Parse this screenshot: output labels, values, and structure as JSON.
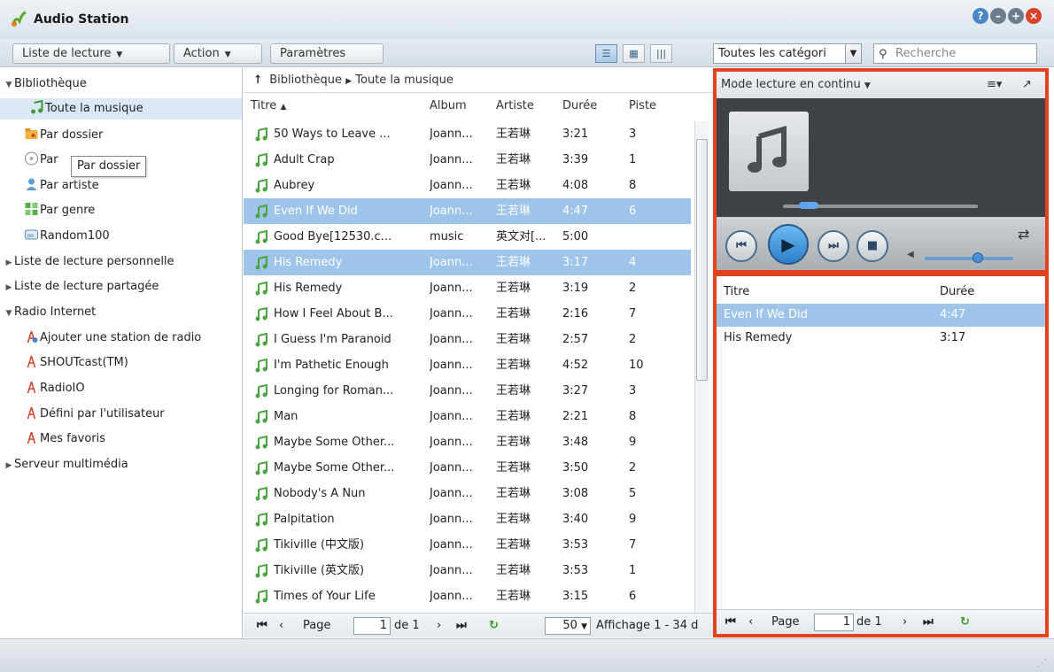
{
  "app": {
    "title": "Audio Station"
  },
  "toolbar": {
    "playlist_label": "Liste de lecture",
    "action_label": "Action",
    "settings_label": "Paramètres",
    "category_value": "Toutes les catégori",
    "search_placeholder": "Recherche"
  },
  "sidebar": {
    "library": "Bibliothèque",
    "all_music": "Toute la musique",
    "by_folder": "Par dossier",
    "by_album": "Par ",
    "by_artist": "Par artiste",
    "by_genre": "Par genre",
    "random100": "Random100",
    "personal_playlist": "Liste de lecture personnelle",
    "shared_playlist": "Liste de lecture partagée",
    "internet_radio": "Radio Internet",
    "add_station": "Ajouter une station de radio",
    "shoutcast": "SHOUTcast(TM)",
    "radioio": "RadioIO",
    "user_defined": "Défini par l'utilisateur",
    "favorites": "Mes favoris",
    "media_server": "Serveur multimédia",
    "tooltip": "Par dossier"
  },
  "center": {
    "breadcrumb_root": "Bibliothèque",
    "breadcrumb_current": "Toute la musique",
    "columns": {
      "title": "Titre",
      "album": "Album",
      "artist": "Artiste",
      "duration": "Durée",
      "track": "Piste"
    },
    "rows": [
      {
        "title": "50 Ways to Leave ...",
        "album": "Joann...",
        "artist": "王若琳",
        "duration": "3:21",
        "track": "3",
        "selected": false
      },
      {
        "title": "Adult Crap",
        "album": "Joann...",
        "artist": "王若琳",
        "duration": "3:39",
        "track": "1",
        "selected": false
      },
      {
        "title": "Aubrey",
        "album": "Joann...",
        "artist": "王若琳",
        "duration": "4:08",
        "track": "8",
        "selected": false
      },
      {
        "title": "Even If We Did",
        "album": "Joann...",
        "artist": "王若琳",
        "duration": "4:47",
        "track": "6",
        "selected": true
      },
      {
        "title": "Good Bye[12530.c...",
        "album": "music",
        "artist": "英文对[...",
        "duration": "5:00",
        "track": "",
        "selected": false
      },
      {
        "title": "His Remedy",
        "album": "Joann...",
        "artist": "王若琳",
        "duration": "3:17",
        "track": "4",
        "selected": true
      },
      {
        "title": "His Remedy",
        "album": "Joann...",
        "artist": "王若琳",
        "duration": "3:19",
        "track": "2",
        "selected": false
      },
      {
        "title": "How I Feel About B...",
        "album": "Joann...",
        "artist": "王若琳",
        "duration": "2:16",
        "track": "7",
        "selected": false
      },
      {
        "title": "I Guess I'm Paranoid",
        "album": "Joann...",
        "artist": "王若琳",
        "duration": "2:57",
        "track": "2",
        "selected": false
      },
      {
        "title": "I'm Pathetic Enough",
        "album": "Joann...",
        "artist": "王若琳",
        "duration": "4:52",
        "track": "10",
        "selected": false
      },
      {
        "title": "Longing for Roman...",
        "album": "Joann...",
        "artist": "王若琳",
        "duration": "3:27",
        "track": "3",
        "selected": false
      },
      {
        "title": "Man",
        "album": "Joann...",
        "artist": "王若琳",
        "duration": "2:21",
        "track": "8",
        "selected": false
      },
      {
        "title": "Maybe Some Other...",
        "album": "Joann...",
        "artist": "王若琳",
        "duration": "3:48",
        "track": "9",
        "selected": false
      },
      {
        "title": "Maybe Some Other...",
        "album": "Joann...",
        "artist": "王若琳",
        "duration": "3:50",
        "track": "2",
        "selected": false
      },
      {
        "title": "Nobody's A Nun",
        "album": "Joann...",
        "artist": "王若琳",
        "duration": "3:08",
        "track": "5",
        "selected": false
      },
      {
        "title": "Palpitation",
        "album": "Joann...",
        "artist": "王若琳",
        "duration": "3:40",
        "track": "9",
        "selected": false
      },
      {
        "title": "Tikiville (中文版)",
        "album": "Joann...",
        "artist": "王若琳",
        "duration": "3:53",
        "track": "7",
        "selected": false
      },
      {
        "title": "Tikiville (英文版)",
        "album": "Joann...",
        "artist": "王若琳",
        "duration": "3:53",
        "track": "1",
        "selected": false
      },
      {
        "title": "Times of Your Life",
        "album": "Joann...",
        "artist": "王若琳",
        "duration": "3:15",
        "track": "6",
        "selected": false
      }
    ],
    "pager": {
      "page_label": "Page",
      "page_value": "1",
      "of_label": "de 1",
      "page_size": "50",
      "display_text": "Affichage 1 - 34 d"
    }
  },
  "player": {
    "mode_label": "Mode lecture en continu",
    "progress_fraction": 0.1,
    "volume_fraction": 0.6,
    "playlist_columns": {
      "title": "Titre",
      "duration": "Durée"
    },
    "playlist": [
      {
        "title": "Even If We Did",
        "duration": "4:47",
        "selected": true
      },
      {
        "title": "His Remedy",
        "duration": "3:17",
        "selected": false
      }
    ],
    "pager": {
      "page_label": "Page",
      "page_value": "1",
      "of_label": "de 1"
    }
  },
  "colors": {
    "highlight_frame": "#e1431e",
    "selection": "#9ec4ea",
    "play_button": "#2c7fc6"
  }
}
